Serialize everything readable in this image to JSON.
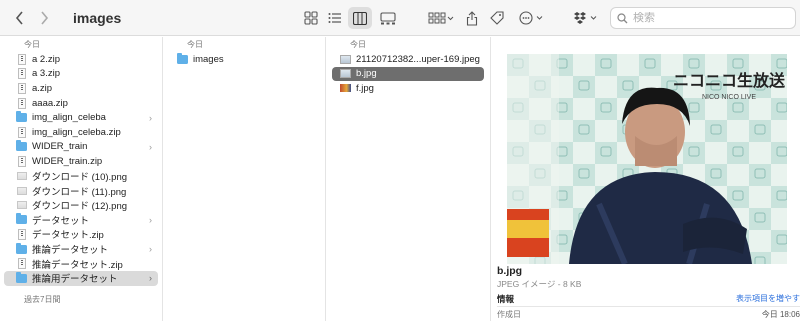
{
  "window": {
    "title": "images"
  },
  "search": {
    "placeholder": "検索"
  },
  "toolbar_icons": [
    "back-icon",
    "forward-icon",
    "grid-view-icon",
    "list-view-icon",
    "column-view-icon",
    "gallery-view-icon",
    "group-icon",
    "share-icon",
    "tag-icon",
    "more-icon",
    "dropbox-icon",
    "search-icon"
  ],
  "col1": {
    "header_today": "今日",
    "header_recent": "過去7日間",
    "items": [
      {
        "label": "a 2.zip",
        "type": "zip",
        "folder": false
      },
      {
        "label": "a 3.zip",
        "type": "zip",
        "folder": false
      },
      {
        "label": "a.zip",
        "type": "zip",
        "folder": false
      },
      {
        "label": "aaaa.zip",
        "type": "zip",
        "folder": false
      },
      {
        "label": "img_align_celeba",
        "type": "folder",
        "folder": true
      },
      {
        "label": "img_align_celeba.zip",
        "type": "zip",
        "folder": false
      },
      {
        "label": "WIDER_train",
        "type": "folder",
        "folder": true
      },
      {
        "label": "WIDER_train.zip",
        "type": "zip",
        "folder": false
      },
      {
        "label": "ダウンロード (10).png",
        "type": "png",
        "folder": false
      },
      {
        "label": "ダウンロード (11).png",
        "type": "png",
        "folder": false
      },
      {
        "label": "ダウンロード (12).png",
        "type": "png",
        "folder": false
      },
      {
        "label": "データセット",
        "type": "folder",
        "folder": true
      },
      {
        "label": "データセット.zip",
        "type": "zip",
        "folder": false
      },
      {
        "label": "推論データセット",
        "type": "folder",
        "folder": true
      },
      {
        "label": "推論データセット.zip",
        "type": "zip",
        "folder": false
      },
      {
        "label": "推論用データセット",
        "type": "folder",
        "folder": true,
        "selected": true
      }
    ]
  },
  "col2": {
    "header": "今日",
    "items": [
      {
        "label": "images",
        "type": "folder"
      }
    ]
  },
  "col3": {
    "header": "今日",
    "items": [
      {
        "label": "21120712382...uper-169.jpeg",
        "type": "jpeg"
      },
      {
        "label": "b.jpg",
        "type": "jpg",
        "selected": true
      },
      {
        "label": "f.jpg",
        "type": "jpg2"
      }
    ]
  },
  "preview": {
    "filename": "b.jpg",
    "filetype": "JPEG イメージ - 8 KB",
    "info_header": "情報",
    "info_more": "表示項目を増やす",
    "created_label": "作成日",
    "created_value": "今日 18:06",
    "banner_text_1": "ニコニコ生放送",
    "banner_text_2": "NICO NICO LIVE"
  }
}
